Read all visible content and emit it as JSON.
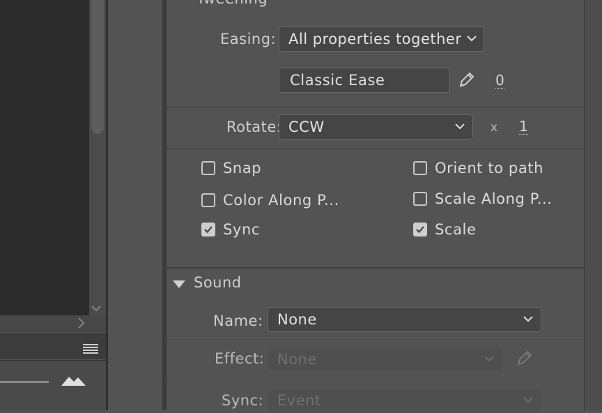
{
  "tweening": {
    "section_title": "Tweening",
    "easing_label": "Easing:",
    "easing_value": "All properties together",
    "ease_field_value": "Classic Ease",
    "ease_amount": "0",
    "rotate_label": "Rotate:",
    "rotate_value": "CCW",
    "times_label": "x",
    "rotate_count": "1",
    "checkboxes": {
      "snap": "Snap",
      "orient_to_path": "Orient to path",
      "color_along_path": "Color Along P...",
      "scale_along_path": "Scale Along P...",
      "sync": "Sync",
      "scale": "Scale"
    },
    "checked": {
      "snap": false,
      "orient_to_path": false,
      "color_along_path": false,
      "scale_along_path": false,
      "sync": true,
      "scale": true
    }
  },
  "sound": {
    "section_title": "Sound",
    "name_label": "Name:",
    "name_value": "None",
    "effect_label": "Effect:",
    "effect_value": "None",
    "sync_label": "Sync:",
    "sync_value": "Event"
  },
  "icons": [
    "pencil-icon",
    "chevron-down-icon",
    "disclosure-triangle-icon",
    "panel-menu-icon",
    "mountain-icon",
    "chevron-right-icon"
  ],
  "colors": {
    "panel_bg": "#535353",
    "stage_bg": "#2b2b2b",
    "text": "#d6d6d6"
  }
}
